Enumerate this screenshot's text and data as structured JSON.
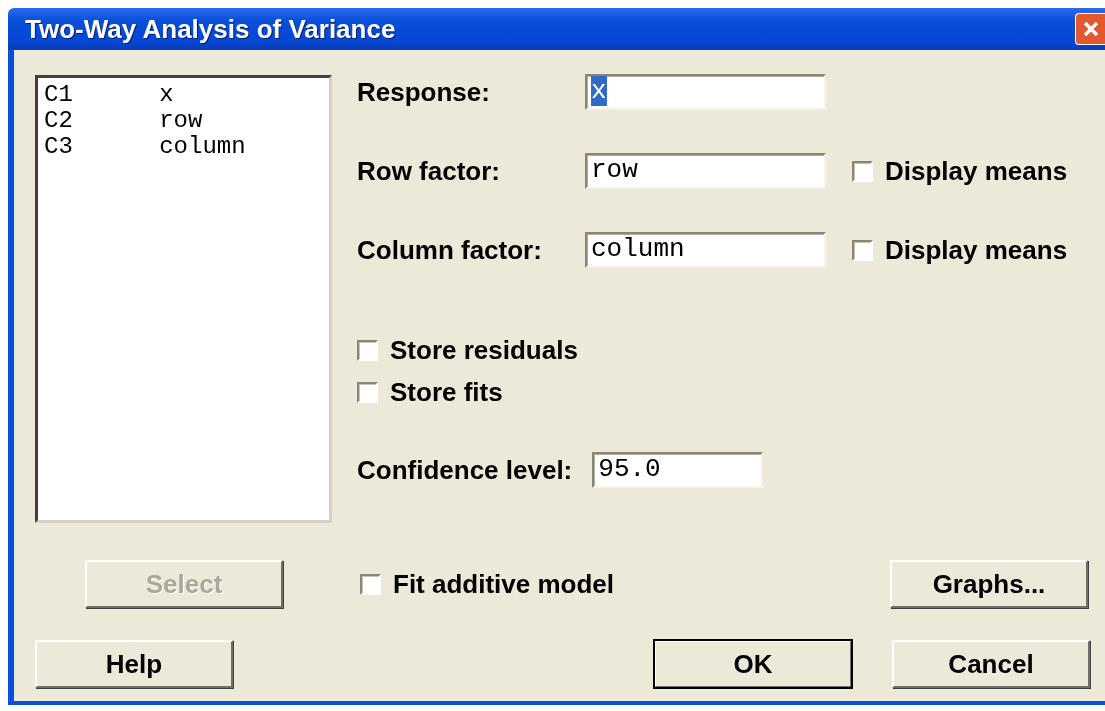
{
  "window": {
    "title": "Two-Way Analysis of Variance"
  },
  "column_list": [
    {
      "column": "C1",
      "name": "x"
    },
    {
      "column": "C2",
      "name": "row"
    },
    {
      "column": "C3",
      "name": "column"
    }
  ],
  "fields": [
    {
      "label": "Response:",
      "value": "x",
      "selected": true
    },
    {
      "label": "Row factor:",
      "value": "row",
      "selected": false,
      "option": {
        "label": "Display means",
        "checked": false
      }
    },
    {
      "label": "Column factor:",
      "value": "column",
      "selected": false,
      "option": {
        "label": "Display means",
        "checked": false
      }
    }
  ],
  "options": [
    {
      "label": "Store residuals",
      "checked": false
    },
    {
      "label": "Store fits",
      "checked": false
    }
  ],
  "confidence": {
    "label": "Confidence level:",
    "value": "95.0"
  },
  "select_button": {
    "label": "Select",
    "disabled": true
  },
  "fit_additive": {
    "label": "Fit additive model",
    "checked": false
  },
  "graphs_button": {
    "label": "Graphs...",
    "disabled": false
  },
  "buttons": [
    {
      "label": "Help",
      "default": false
    },
    {
      "label": "OK",
      "default": true
    },
    {
      "label": "Cancel",
      "default": false
    }
  ]
}
